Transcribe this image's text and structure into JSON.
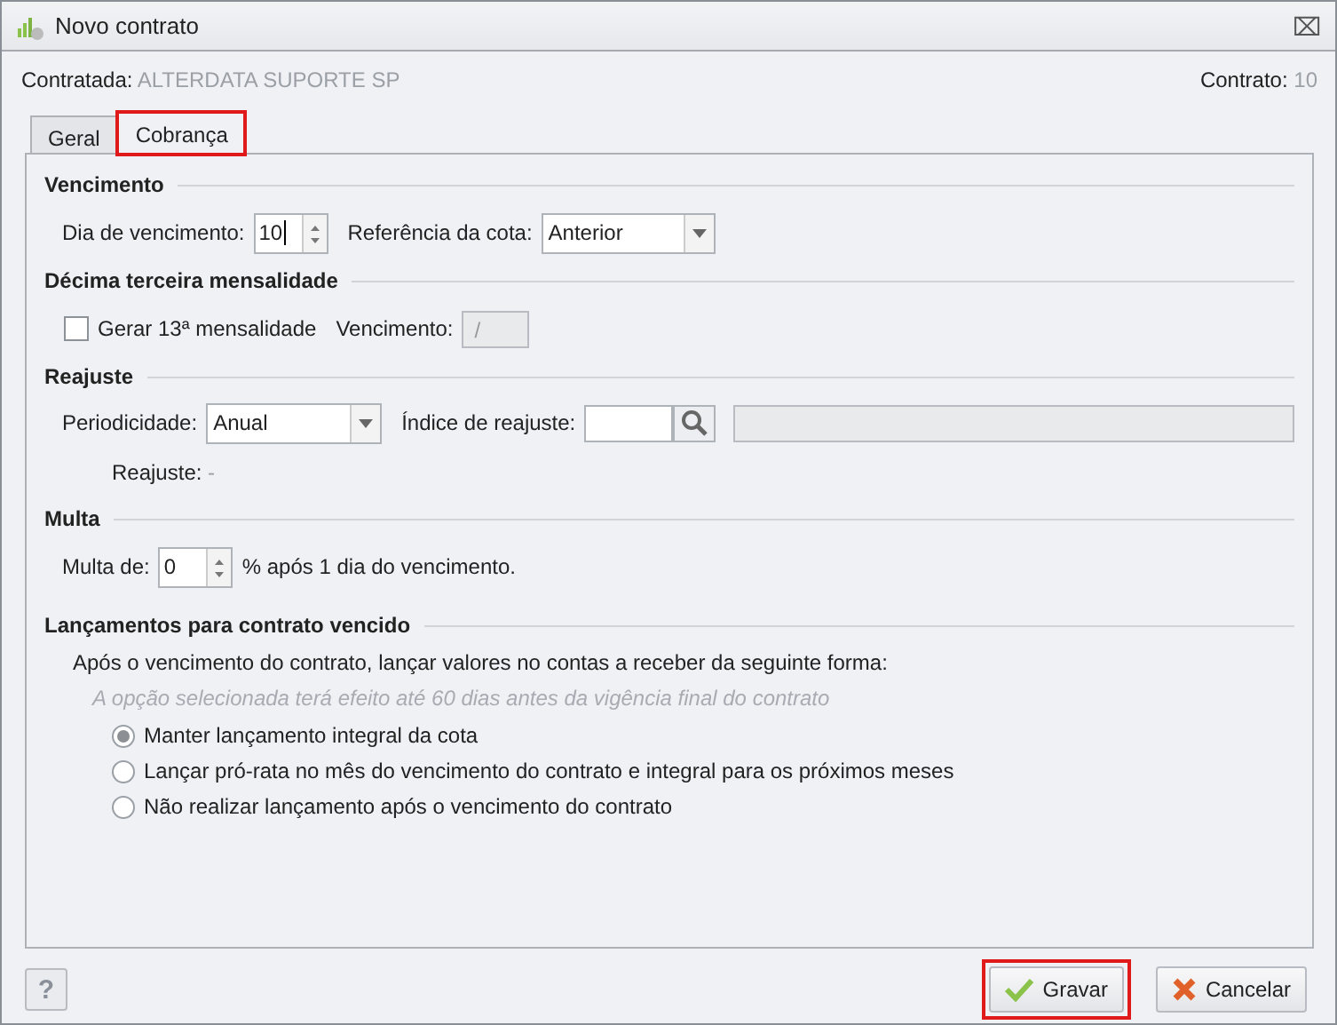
{
  "window": {
    "title": "Novo contrato",
    "close": "⌧"
  },
  "header": {
    "contratada_label": "Contratada:",
    "contratada_value": "ALTERDATA SUPORTE SP",
    "contrato_label": "Contrato:",
    "contrato_value": "10"
  },
  "tabs": [
    {
      "label": "Geral",
      "selected": false,
      "highlighted": false
    },
    {
      "label": "Cobrança",
      "selected": true,
      "highlighted": true
    }
  ],
  "vencimento": {
    "title": "Vencimento",
    "dia_label": "Dia de vencimento:",
    "dia_value": "10",
    "referencia_label": "Referência da cota:",
    "referencia_value": "Anterior"
  },
  "decima": {
    "title": "Décima terceira mensalidade",
    "checkbox_label": "Gerar 13ª mensalidade",
    "checked": false,
    "vencimento_label": "Vencimento:",
    "vencimento_value": "/"
  },
  "reajuste": {
    "title": "Reajuste",
    "periodicidade_label": "Periodicidade:",
    "periodicidade_value": "Anual",
    "indice_label": "Índice de reajuste:",
    "reajuste_label": "Reajuste:",
    "reajuste_value": "-"
  },
  "multa": {
    "title": "Multa",
    "label": "Multa de:",
    "value": "0",
    "suffix": "% após 1 dia do vencimento."
  },
  "lancamentos": {
    "title": "Lançamentos para contrato vencido",
    "description": "Após o vencimento do contrato, lançar valores no contas a receber da seguinte forma:",
    "hint": "A opção selecionada terá efeito até 60 dias antes da vigência final do contrato",
    "options": [
      {
        "label": "Manter lançamento integral da cota",
        "selected": true
      },
      {
        "label": "Lançar pró-rata no mês do vencimento do contrato e integral para os próximos meses",
        "selected": false
      },
      {
        "label": "Não realizar lançamento após o vencimento do contrato",
        "selected": false
      }
    ]
  },
  "footer": {
    "help": "?",
    "buttons": [
      {
        "label": "Gravar",
        "kind": "save",
        "highlighted": true
      },
      {
        "label": "Cancelar",
        "kind": "cancel",
        "highlighted": false
      }
    ]
  }
}
